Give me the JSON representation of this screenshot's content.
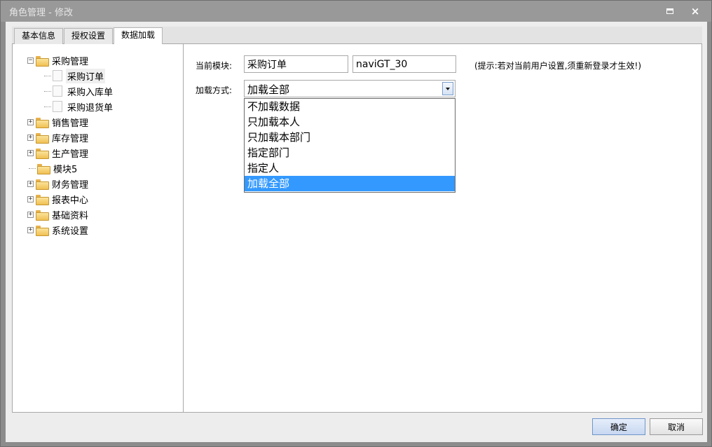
{
  "window": {
    "title": "角色管理 - 修改",
    "maximize_icon": "maximize-icon",
    "close_icon": "close-icon"
  },
  "tabs": [
    {
      "label": "基本信息"
    },
    {
      "label": "授权设置"
    },
    {
      "label": "数据加载",
      "active": true
    }
  ],
  "tree": {
    "nodes": [
      {
        "label": "采购管理",
        "expander": "−",
        "expanded": true
      },
      {
        "label": "采购订单",
        "selected": true
      },
      {
        "label": "采购入库单"
      },
      {
        "label": "采购退货单"
      },
      {
        "label": "销售管理",
        "expander": "+"
      },
      {
        "label": "库存管理",
        "expander": "+"
      },
      {
        "label": "生产管理",
        "expander": "+"
      },
      {
        "label": "模块5"
      },
      {
        "label": "财务管理",
        "expander": "+"
      },
      {
        "label": "报表中心",
        "expander": "+"
      },
      {
        "label": "基础资料",
        "expander": "+"
      },
      {
        "label": "系统设置",
        "expander": "+"
      }
    ]
  },
  "form": {
    "module_label": "当前模块:",
    "module_name": "采购订单",
    "module_code": "naviGT_30",
    "hint": "(提示:若对当前用户设置,须重新登录才生效!)",
    "load_label": "加载方式:",
    "load_value": "加载全部",
    "options": [
      "不加载数据",
      "只加载本人",
      "只加载本部门",
      "指定部门",
      "指定人",
      "加载全部"
    ],
    "selected_option_index": 5
  },
  "footer": {
    "ok_label": "确定",
    "cancel_label": "取消"
  },
  "colors": {
    "titlebar": "#999999",
    "selection": "#3399ff",
    "folder": "#f0c053"
  }
}
